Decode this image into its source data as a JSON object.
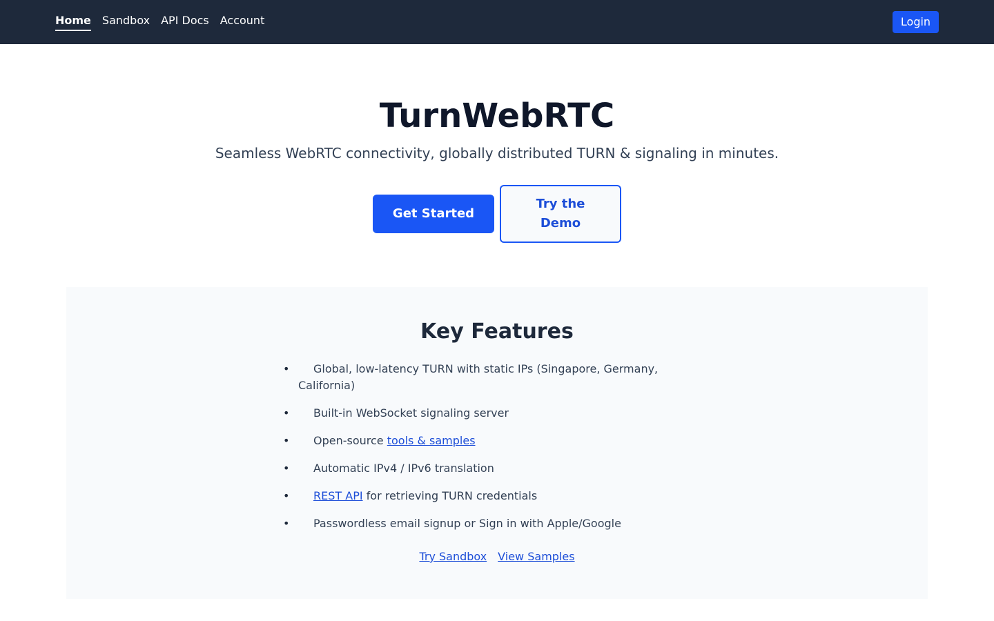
{
  "nav": {
    "links": [
      {
        "label": "Home",
        "active": true
      },
      {
        "label": "Sandbox",
        "active": false
      },
      {
        "label": "API Docs",
        "active": false
      },
      {
        "label": "Account",
        "active": false
      }
    ],
    "login_label": "Login"
  },
  "hero": {
    "title": "TurnWebRTC",
    "subtitle": "Seamless WebRTC connectivity, globally distributed TURN & signaling in minutes.",
    "primary_cta": "Get Started",
    "secondary_cta": "Try the Demo"
  },
  "features": {
    "title": "Key Features",
    "items": [
      {
        "before": "Global, low-latency TURN with static IPs (Singapore, Germany, California)",
        "link": "",
        "after": ""
      },
      {
        "before": "Built-in WebSocket signaling server",
        "link": "",
        "after": ""
      },
      {
        "before": "Open-source ",
        "link": "tools & samples",
        "after": ""
      },
      {
        "before": "Automatic IPv4 / IPv6 translation",
        "link": "",
        "after": ""
      },
      {
        "before": "",
        "link": "REST API",
        "after": " for retrieving TURN credentials"
      },
      {
        "before": "Passwordless email signup or Sign in with Apple/Google",
        "link": "",
        "after": ""
      }
    ],
    "links": [
      "Try Sandbox",
      "View Samples"
    ]
  },
  "colors": {
    "nav_bg": "#1e293b",
    "accent": "#1a56f5",
    "link": "#1d4ed8",
    "section_bg": "#f8fafc"
  }
}
